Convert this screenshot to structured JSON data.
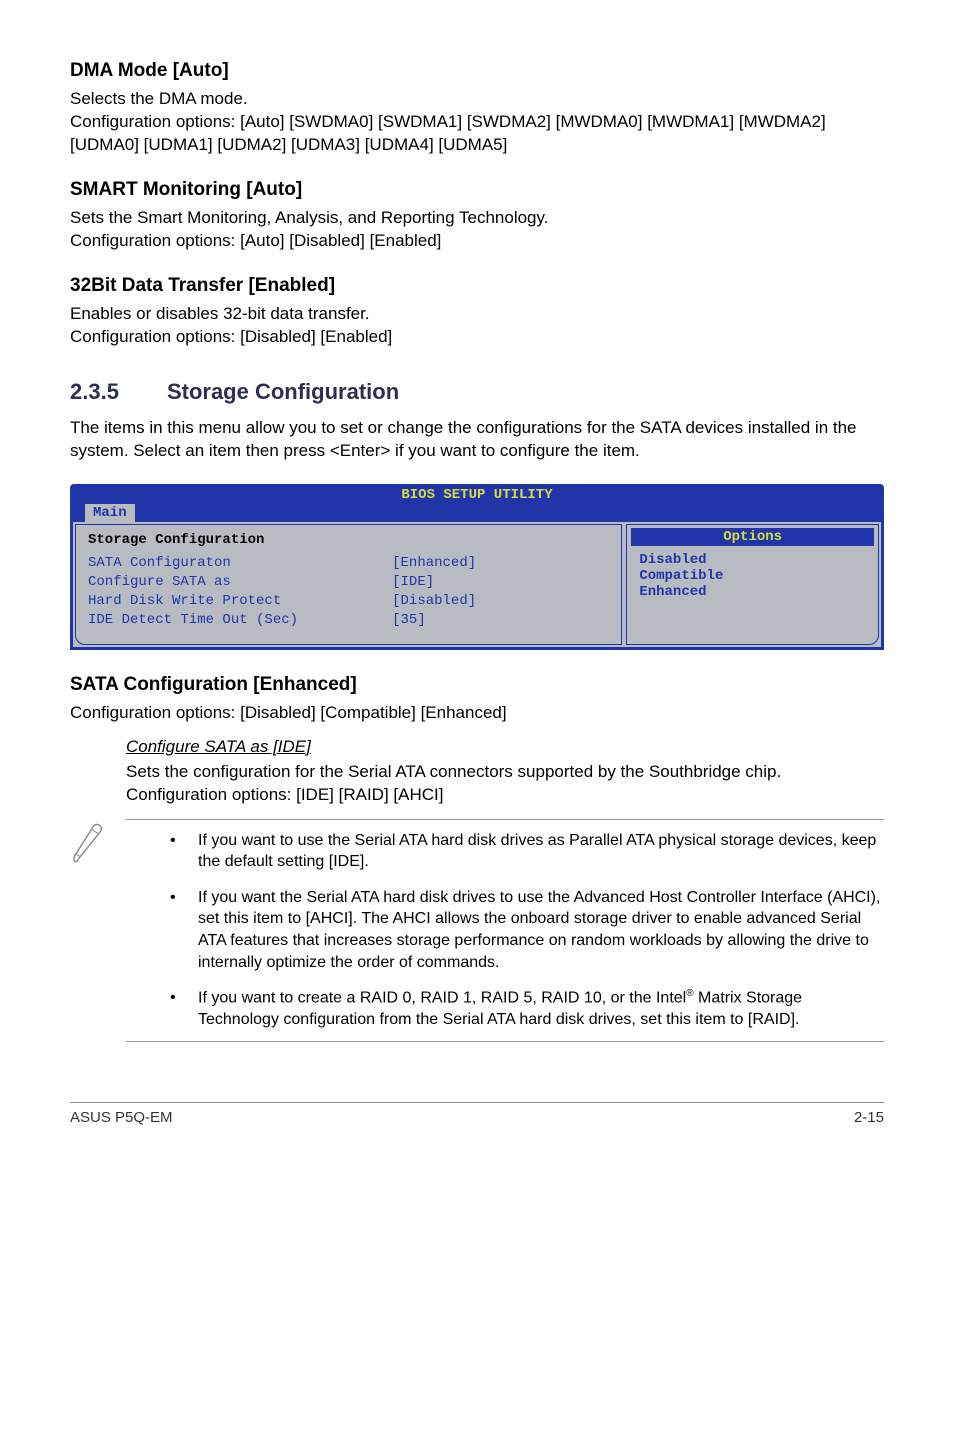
{
  "sections": {
    "dma": {
      "heading": "DMA Mode [Auto]",
      "line1": "Selects the DMA mode.",
      "line2": "Configuration options: [Auto] [SWDMA0] [SWDMA1] [SWDMA2] [MWDMA0] [MWDMA1] [MWDMA2] [UDMA0] [UDMA1] [UDMA2] [UDMA3] [UDMA4] [UDMA5]"
    },
    "smart": {
      "heading": "SMART Monitoring [Auto]",
      "line1": "Sets the Smart Monitoring, Analysis, and Reporting Technology.",
      "line2": "Configuration options: [Auto] [Disabled] [Enabled]"
    },
    "bit32": {
      "heading": "32Bit Data Transfer [Enabled]",
      "line1": "Enables or disables 32-bit data transfer.",
      "line2": "Configuration options: [Disabled] [Enabled]"
    },
    "storage": {
      "num": "2.3.5",
      "title": "Storage Configuration",
      "intro": "The items in this menu allow you to set or change the configurations for the SATA devices installed in the system. Select an item then press <Enter> if you want to configure the item."
    },
    "sata": {
      "heading": "SATA Configuration [Enhanced]",
      "line1": "Configuration options: [Disabled] [Compatible] [Enhanced]",
      "sub_heading": "Configure SATA as [IDE]",
      "sub_body": "Sets the configuration for the Serial ATA connectors supported by the Southbridge chip. Configuration options: [IDE] [RAID] [AHCI]"
    }
  },
  "bios": {
    "header": "BIOS SETUP UTILITY",
    "tab": "Main",
    "left_title": "Storage Configuration",
    "rows": [
      {
        "label": "SATA Configuraton",
        "value": "[Enhanced]"
      },
      {
        "label": " Configure SATA as",
        "value": "[IDE]"
      },
      {
        "label": "",
        "value": ""
      },
      {
        "label": "Hard Disk Write Protect",
        "value": "[Disabled]"
      },
      {
        "label": "IDE Detect Time Out (Sec)",
        "value": "[35]"
      }
    ],
    "options_title": "Options",
    "options": [
      "Disabled",
      "Compatible",
      "Enhanced"
    ]
  },
  "notes": {
    "item1": "If you want to use the Serial ATA hard disk drives as Parallel ATA physical storage devices, keep the default setting [IDE].",
    "item2": "If you want the Serial ATA hard disk drives to use the Advanced Host Controller Interface (AHCI), set this item to [AHCI]. The AHCI allows the onboard storage driver to enable advanced Serial ATA features that increases storage performance on random workloads by allowing the drive to internally optimize the order of commands.",
    "item3_pre": "If you want to create a RAID 0, RAID 1, RAID 5, RAID 10, or the Intel",
    "item3_post": " Matrix Storage Technology configuration from the Serial ATA hard disk drives, set this item to [RAID]."
  },
  "footer": {
    "left": "ASUS P5Q-EM",
    "right": "2-15"
  }
}
